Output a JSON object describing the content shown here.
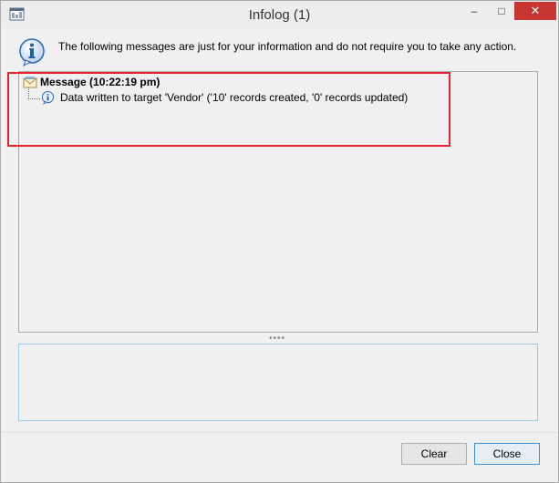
{
  "window": {
    "title": "Infolog (1)",
    "minimize_glyph": "–",
    "maximize_glyph": "□",
    "close_glyph": "✕"
  },
  "header": {
    "message": "The following messages are just for your information and do not require you to take any action."
  },
  "tree": {
    "group_label": "Message (10:22:19 pm)",
    "items": [
      {
        "text": "Data written to target 'Vendor' ('10' records created, '0' records updated)"
      }
    ]
  },
  "splitter": {
    "glyph": "••••"
  },
  "buttons": {
    "clear_label": "Clear",
    "close_label": "Close"
  },
  "colors": {
    "highlight": "#e8232e",
    "close_button": "#c7372f",
    "info_icon": "#1f5fa8"
  }
}
